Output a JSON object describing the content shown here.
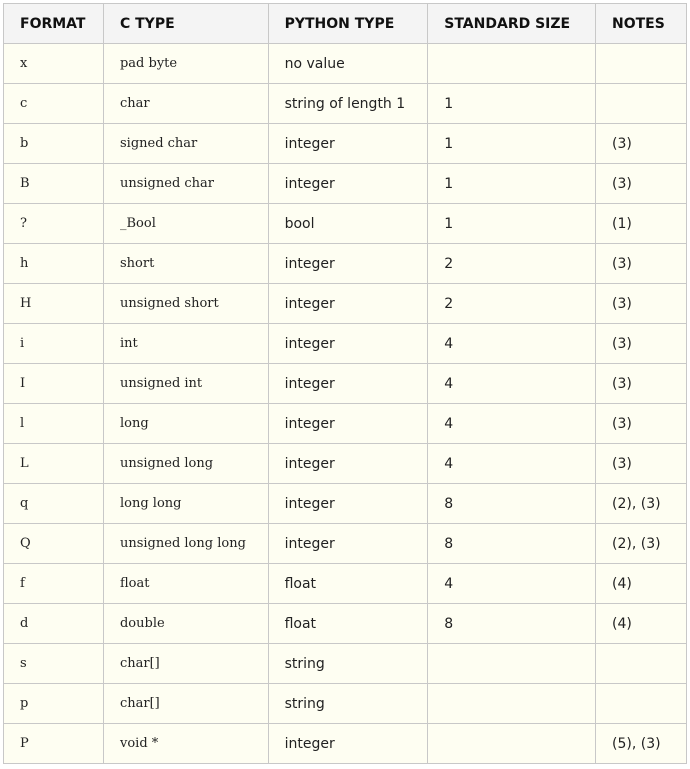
{
  "table": {
    "headers": [
      "FORMAT",
      "C TYPE",
      "PYTHON TYPE",
      "STANDARD SIZE",
      "NOTES"
    ],
    "rows": [
      {
        "format": "x",
        "c_type": "pad byte",
        "python_type": "no value",
        "standard_size": "",
        "notes": ""
      },
      {
        "format": "c",
        "c_type": "char",
        "python_type": "string of length 1",
        "standard_size": "1",
        "notes": ""
      },
      {
        "format": "b",
        "c_type": "signed char",
        "python_type": "integer",
        "standard_size": "1",
        "notes": "(3)"
      },
      {
        "format": "B",
        "c_type": "unsigned char",
        "python_type": "integer",
        "standard_size": "1",
        "notes": "(3)"
      },
      {
        "format": "?",
        "c_type": "_Bool",
        "python_type": "bool",
        "standard_size": "1",
        "notes": "(1)"
      },
      {
        "format": "h",
        "c_type": "short",
        "python_type": "integer",
        "standard_size": "2",
        "notes": "(3)"
      },
      {
        "format": "H",
        "c_type": "unsigned short",
        "python_type": "integer",
        "standard_size": "2",
        "notes": "(3)"
      },
      {
        "format": "i",
        "c_type": "int",
        "python_type": "integer",
        "standard_size": "4",
        "notes": "(3)"
      },
      {
        "format": "I",
        "c_type": "unsigned int",
        "python_type": "integer",
        "standard_size": "4",
        "notes": "(3)"
      },
      {
        "format": "l",
        "c_type": "long",
        "python_type": "integer",
        "standard_size": "4",
        "notes": "(3)"
      },
      {
        "format": "L",
        "c_type": "unsigned long",
        "python_type": "integer",
        "standard_size": "4",
        "notes": "(3)"
      },
      {
        "format": "q",
        "c_type": "long long",
        "python_type": "integer",
        "standard_size": "8",
        "notes": "(2), (3)"
      },
      {
        "format": "Q",
        "c_type": "unsigned long long",
        "python_type": "integer",
        "standard_size": "8",
        "notes": "(2), (3)"
      },
      {
        "format": "f",
        "c_type": "float",
        "python_type": "float",
        "standard_size": "4",
        "notes": "(4)"
      },
      {
        "format": "d",
        "c_type": "double",
        "python_type": "float",
        "standard_size": "8",
        "notes": "(4)"
      },
      {
        "format": "s",
        "c_type": "char[]",
        "python_type": "string",
        "standard_size": "",
        "notes": ""
      },
      {
        "format": "p",
        "c_type": "char[]",
        "python_type": "string",
        "standard_size": "",
        "notes": ""
      },
      {
        "format": "P",
        "c_type": "void *",
        "python_type": "integer",
        "standard_size": "",
        "notes": "(5), (3)"
      }
    ]
  }
}
